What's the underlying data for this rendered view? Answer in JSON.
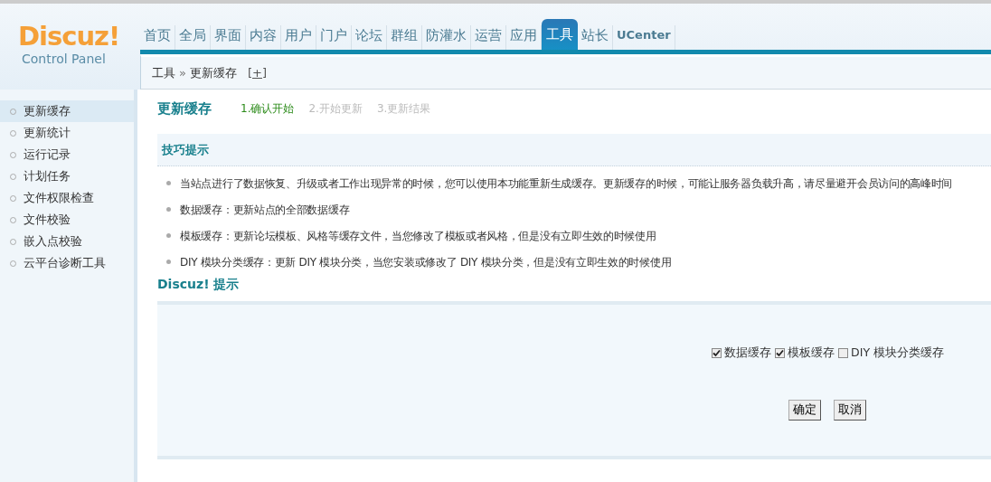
{
  "logo": {
    "brand": "Discuz!",
    "subtitle": "Control Panel"
  },
  "nav": [
    {
      "label": "首页",
      "selected": false
    },
    {
      "label": "全局",
      "selected": false
    },
    {
      "label": "界面",
      "selected": false
    },
    {
      "label": "内容",
      "selected": false
    },
    {
      "label": "用户",
      "selected": false
    },
    {
      "label": "门户",
      "selected": false
    },
    {
      "label": "论坛",
      "selected": false
    },
    {
      "label": "群组",
      "selected": false
    },
    {
      "label": "防灌水",
      "selected": false
    },
    {
      "label": "运营",
      "selected": false
    },
    {
      "label": "应用",
      "selected": false
    },
    {
      "label": "工具",
      "selected": true
    },
    {
      "label": "站长",
      "selected": false
    },
    {
      "label": "UCenter",
      "selected": false
    }
  ],
  "breadcrumb": {
    "parent": "工具",
    "separator": "»",
    "current": "更新缓存",
    "toggle": "[+]"
  },
  "sidebar": {
    "items": [
      {
        "label": "更新缓存",
        "selected": true
      },
      {
        "label": "更新统计",
        "selected": false
      },
      {
        "label": "运行记录",
        "selected": false
      },
      {
        "label": "计划任务",
        "selected": false
      },
      {
        "label": "文件权限检查",
        "selected": false
      },
      {
        "label": "文件校验",
        "selected": false
      },
      {
        "label": "嵌入点校验",
        "selected": false
      },
      {
        "label": "云平台诊断工具",
        "selected": false
      }
    ]
  },
  "page_title": "更新缓存",
  "steps": [
    {
      "label": "1.确认开始",
      "selected": true
    },
    {
      "label": "2.开始更新",
      "selected": false
    },
    {
      "label": "3.更新结果",
      "selected": false
    }
  ],
  "tips": {
    "title": "技巧提示",
    "items": [
      "当站点进行了数据恢复、升级或者工作出现异常的时候，您可以使用本功能重新生成缓存。更新缓存的时候，可能让服务器负载升高，请尽量避开会员访问的高峰时间",
      "数据缓存：更新站点的全部数据缓存",
      "模板缓存：更新论坛模板、风格等缓存文件，当您修改了模板或者风格，但是没有立即生效的时候使用",
      "DIY 模块分类缓存：更新 DIY 模块分类，当您安装或修改了 DIY 模块分类，但是没有立即生效的时候使用"
    ]
  },
  "notice": {
    "title": "Discuz! 提示",
    "options": [
      {
        "label": "数据缓存",
        "checked": true
      },
      {
        "label": "模板缓存",
        "checked": true
      },
      {
        "label": "DIY 模块分类缓存",
        "checked": false
      }
    ],
    "buttons": [
      "确定",
      "取消"
    ]
  }
}
